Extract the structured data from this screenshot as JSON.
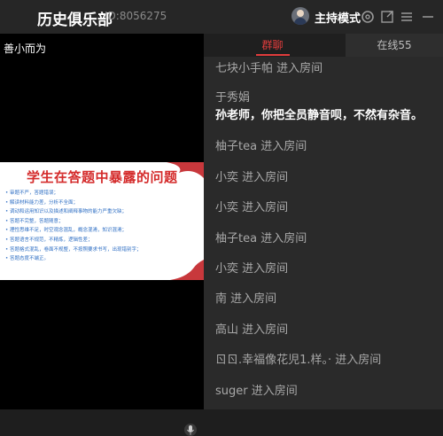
{
  "header": {
    "title": "历史俱乐部",
    "room_id": "ID:8056275",
    "host_mode": "主持模式"
  },
  "video": {
    "speaker_name": "善小而为",
    "slide": {
      "title": "学生在答题中暴露的问题",
      "items": [
        "• 审题不严，答题错误；",
        "• 解读材料能力差，分析不全面；",
        "• 调动和运用知识以及描述和阐释事物的能力严重欠缺；",
        "• 答题不完整，答题随意；",
        "• 理性思维不足，时空观念混乱，概念混淆，知识混淆；",
        "• 答题语言不规范，不精炼，逻辑性差；",
        "• 答题格式混乱，卷面不规整，不按照要求书写，出现错别字；",
        "• 答题态度不端正。"
      ]
    }
  },
  "chat": {
    "tab_group": "群聊",
    "tab_online": "在线55",
    "messages": [
      {
        "text": "七块小手帕 进入房间"
      },
      {
        "text": "于秀娟"
      },
      {
        "text": "孙老师，你把全员静音呗，不然有杂音。"
      },
      {
        "text": "柚子tea 进入房间"
      },
      {
        "text": "小奕 进入房间"
      },
      {
        "text": "小奕 进入房间"
      },
      {
        "text": "柚子tea 进入房间"
      },
      {
        "text": "小奕 进入房间"
      },
      {
        "text": "南 进入房间"
      },
      {
        "text": "高山 进入房间"
      },
      {
        "text": "ㄖㄖ.幸福像花児1.样。· 进入房间"
      },
      {
        "text": "suger 进入房间"
      }
    ]
  },
  "colors": {
    "accent": "#e03c3c",
    "slide_title": "#d42a2a",
    "slide_text": "#2f6fc4"
  },
  "icons": [
    "avatar",
    "settings-icon",
    "popout-icon",
    "menu-icon",
    "minimize-icon",
    "microphone-icon",
    "ribbon-decoration"
  ]
}
